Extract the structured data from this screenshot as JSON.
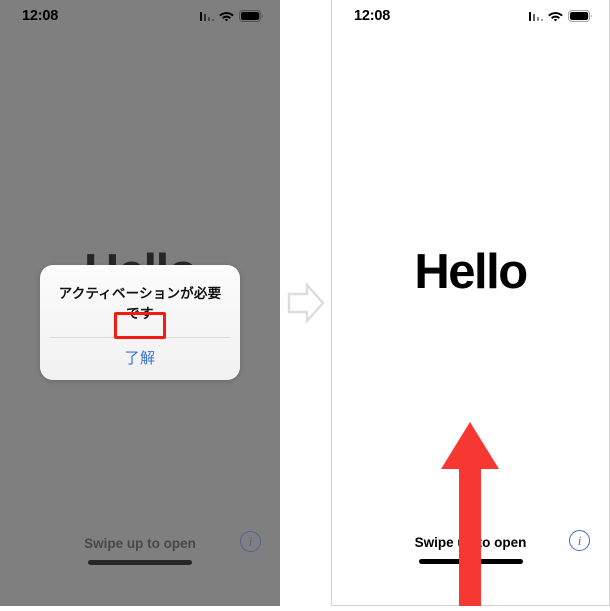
{
  "meta": {
    "scene": "iOS lock screen activation alert, before and after"
  },
  "colors": {
    "dimmed_screen": "#9a9a9a",
    "alert_button_blue": "#3576d6",
    "highlight_red": "#f01d10",
    "arrow_red": "#f73832",
    "info_blue": "#4169c9",
    "transition_arrow": "#dcdcdc",
    "panel_border": "#d2d2d2"
  },
  "panels": {
    "before": {
      "status_bar": {
        "time": "12:08",
        "signal_icon": "cellular-signal-icon",
        "wifi_icon": "wifi-icon",
        "battery_icon": "battery-icon"
      },
      "lock_screen": {
        "greeting": "Hello",
        "swipe_hint": "Swipe up to open",
        "home_indicator": "home-indicator",
        "info_glyph": "i"
      },
      "alert": {
        "message": "アクティベーションが必要です",
        "button_label": "了解"
      }
    },
    "after": {
      "status_bar": {
        "time": "12:08",
        "signal_icon": "cellular-signal-icon",
        "wifi_icon": "wifi-icon",
        "battery_icon": "battery-icon"
      },
      "lock_screen": {
        "greeting": "Hello",
        "swipe_hint": "Swipe up to open",
        "home_indicator": "home-indicator",
        "info_glyph": "i"
      },
      "annotation": {
        "swipe_up_arrow": "swipe-up-arrow"
      }
    }
  },
  "transition": {
    "icon": "right-arrow-icon"
  }
}
